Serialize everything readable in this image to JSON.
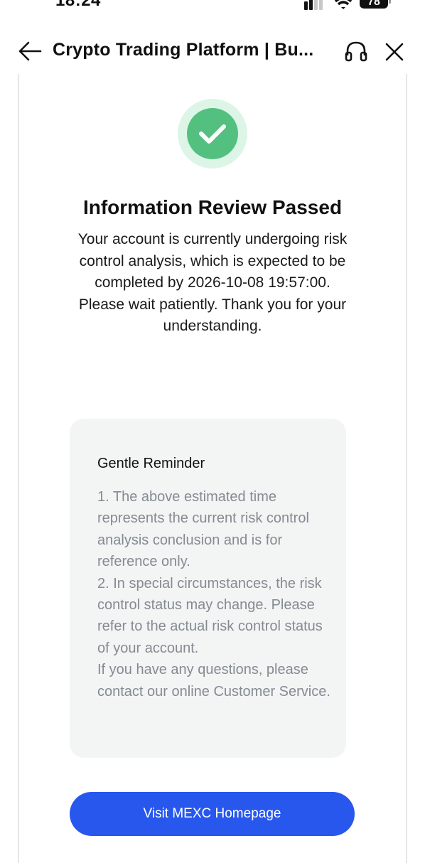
{
  "status_bar": {
    "time": "18:24",
    "battery": "78"
  },
  "nav": {
    "title": "Crypto Trading Platform | Bu..."
  },
  "review": {
    "title": "Information Review Passed",
    "body": "Your account is currently undergoing risk control analysis, which is expected to be completed by 2026-10-08 19:57:00.",
    "wait_text": "Please wait patiently. Thank you for your understanding."
  },
  "reminder": {
    "title": "Gentle Reminder",
    "point_1": "1. The above estimated time represents the current risk control analysis conclusion and is for reference only.",
    "point_2": "2. In special circumstances, the risk control status may change. Please refer to the actual risk control status of your account.",
    "contact": "If you have any questions, please contact our online Customer Service."
  },
  "actions": {
    "home_button_label": "Visit MEXC Homepage"
  },
  "colors": {
    "accent": "#2857ee",
    "success": "#53c07f",
    "card_bg": "#f3f4f4",
    "muted_text": "#848b92"
  },
  "icons": {
    "back": "arrow-left-icon",
    "support": "headset-icon",
    "close": "close-icon",
    "success": "check-circle-icon"
  }
}
